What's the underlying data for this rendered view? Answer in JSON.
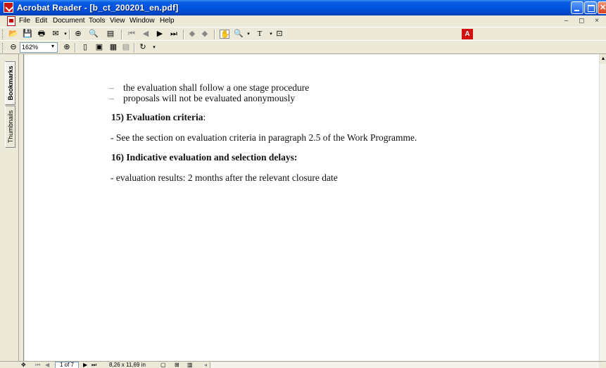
{
  "window": {
    "title": "Acrobat Reader - [b_ct_200201_en.pdf]"
  },
  "menu": [
    "File",
    "Edit",
    "Document",
    "Tools",
    "View",
    "Window",
    "Help"
  ],
  "mdi_controls": "– ◻ ×",
  "toolbar": {
    "zoom_value": "162%",
    "text_select_label": "T"
  },
  "nav_tabs": {
    "bookmarks": "Bookmarks",
    "thumbnails": "Thumbnails"
  },
  "document": {
    "bullets": [
      "the evaluation shall follow a one stage procedure",
      "proposals will not be evaluated anonymously"
    ],
    "bullet_marker": "–",
    "heading_15": "15) Evaluation criteria",
    "heading_15_suffix": ":",
    "para_15": "- See the section on evaluation criteria in paragraph 2.5 of the Work Programme.",
    "heading_16": "16) Indicative evaluation and selection delays:",
    "para_16": "- evaluation results: 2 months after the relevant closure date"
  },
  "statusbar": {
    "page_indicator": "1 of 7",
    "page_size": "8,26 x 11,69 in"
  },
  "colors": {
    "titlebar": "#0053e1",
    "chrome": "#ece9d8",
    "page": "#ffffff",
    "acrobat_red": "#d21010"
  }
}
